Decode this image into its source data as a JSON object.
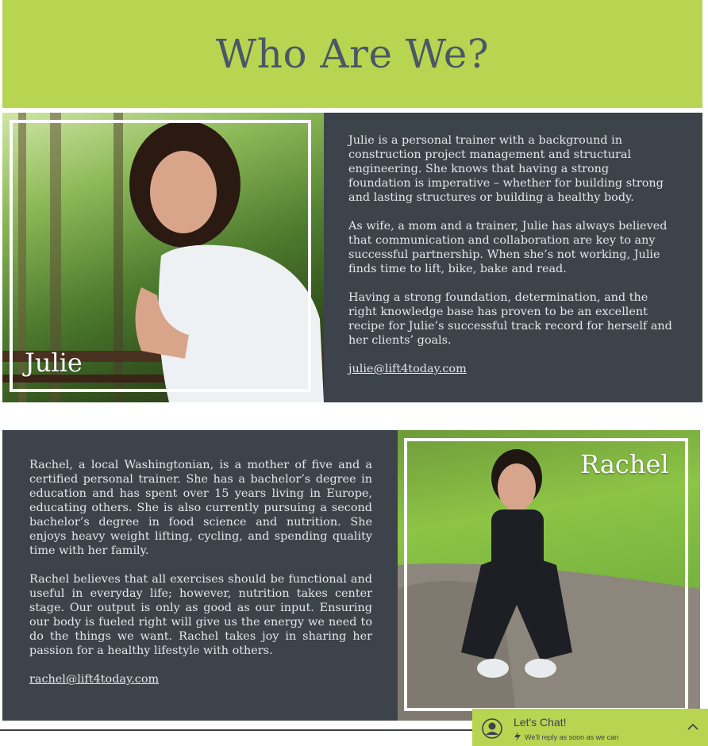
{
  "header": {
    "title": "Who Are We?"
  },
  "julie": {
    "name": "Julie",
    "paragraphs": [
      "Julie is a personal trainer with a background in construction project management and structural engineering. She knows that having a strong foundation is imperative – whether for building strong and lasting structures or building a healthy body.",
      "As wife, a mom and a trainer, Julie has always believed that communication and collaboration are key to any successful partnership.  When she’s not working, Julie finds time to lift, bike, bake and read.",
      "Having a strong foundation, determination, and the right knowledge base has proven to be an excellent recipe for Julie’s successful track record for herself and her clients’ goals."
    ],
    "email": "julie@lift4today.com"
  },
  "rachel": {
    "name": "Rachel",
    "paragraphs": [
      "Rachel, a local Washingtonian, is a mother of five and a certified personal trainer. She has a bachelor’s degree in education and has spent over 15 years living in Europe, educating others. She is also currently pursuing a second bachelor’s degree in food science and nutrition. She enjoys heavy weight lifting, cycling, and spending quality time with her family.",
      "Rachel believes that all exercises should be functional and useful in everyday life; however, nutrition takes center stage. Our output is only as good as our input. Ensuring our body is fueled right will give us the energy we need to do the things we want. Rachel takes joy in sharing her passion for a healthy lifestyle with others."
    ],
    "email": "rachel@lift4today.com"
  },
  "chat": {
    "title": "Let's Chat!",
    "subtitle": "We'll reply as soon as we can",
    "icons": [
      "avatar-icon",
      "lightning-icon",
      "chevron-up-icon"
    ]
  },
  "colors": {
    "accent": "#b8d551",
    "panel": "#3d434b",
    "heading": "#4a5766"
  }
}
